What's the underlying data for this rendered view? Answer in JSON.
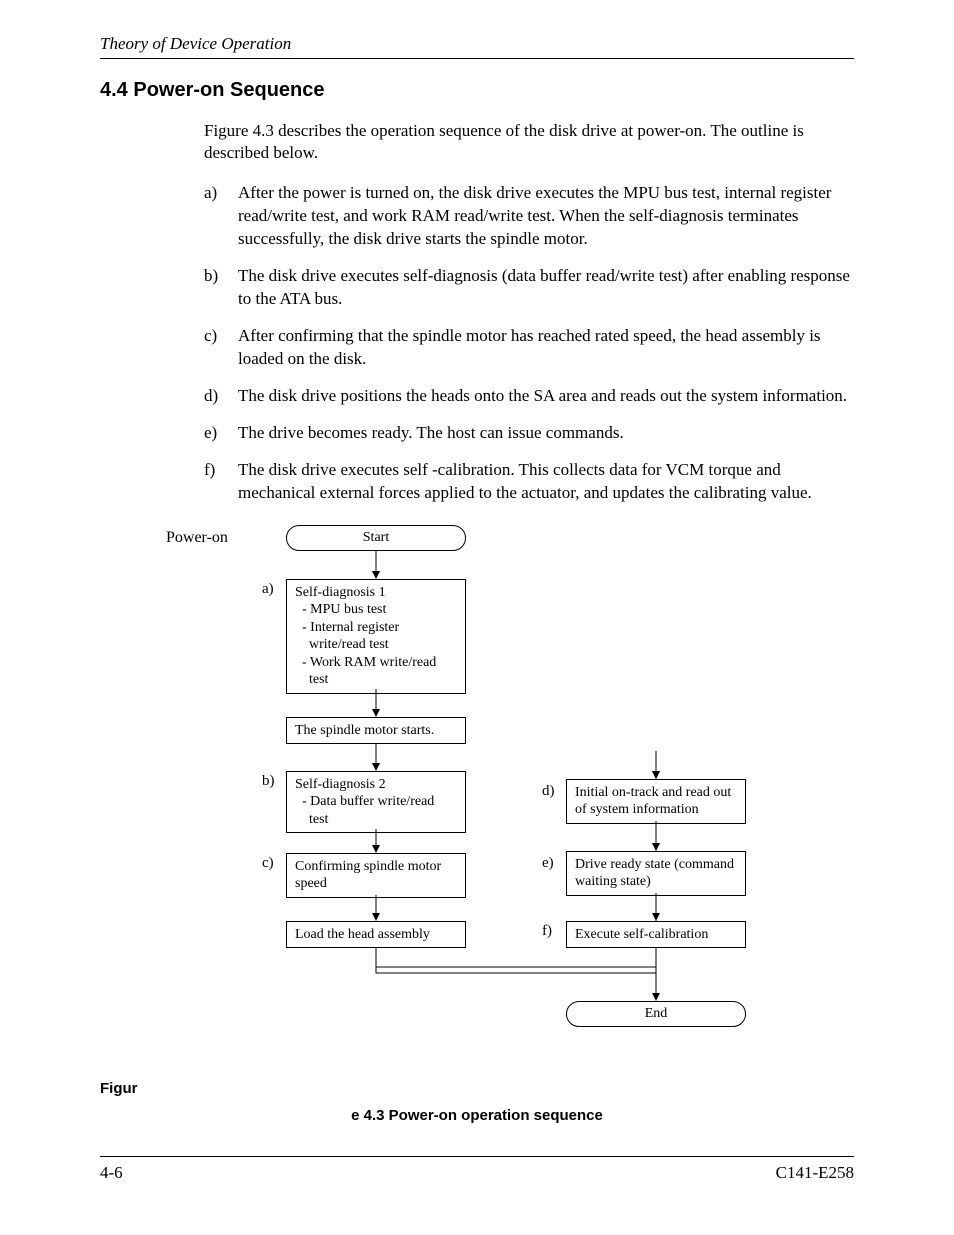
{
  "header": {
    "title": "Theory of Device Operation"
  },
  "section": {
    "heading": "4.4  Power-on Sequence"
  },
  "intro": "Figure 4.3 describes the operation sequence of the disk drive at power-on.  The outline is described below.",
  "items": [
    {
      "label": "a)",
      "text": "After the power is turned on, the disk drive executes the MPU bus test, internal register read/write test, and work RAM read/write test.  When the self-diagnosis terminates successfully, the disk drive starts the spindle motor."
    },
    {
      "label": "b)",
      "text": "The disk drive executes self-diagnosis (data buffer read/write test) after enabling response to the ATA bus."
    },
    {
      "label": "c)",
      "text": "After confirming that the spindle motor has reached rated speed, the head assembly is loaded on the disk."
    },
    {
      "label": "d)",
      "text": "The disk drive positions the heads onto the SA area and reads out the system information."
    },
    {
      "label": "e)",
      "text": "The drive becomes ready.  The host can issue commands."
    },
    {
      "label": "f)",
      "text": "The disk drive executes self -calibration.  This collects data for VCM torque and mechanical external forces applied to the actuator, and updates the calibrating value."
    }
  ],
  "flow": {
    "poweron": "Power-on",
    "start": "Start",
    "end": "End",
    "a_label": "a)",
    "b_label": "b)",
    "c_label": "c)",
    "d_label": "d)",
    "e_label": "e)",
    "f_label": "f)",
    "box_a_title": "Self-diagnosis 1",
    "box_a_l1": "- MPU bus test",
    "box_a_l2": "- Internal register",
    "box_a_l2b": "write/read test",
    "box_a_l3": "- Work RAM write/read",
    "box_a_l3b": "test",
    "box_spindle": "The spindle motor starts.",
    "box_b_title": "Self-diagnosis 2",
    "box_b_l1": "- Data buffer write/read",
    "box_b_l1b": "test",
    "box_c": "Confirming spindle motor speed",
    "box_load": "Load the head assembly",
    "box_d": "Initial on-track and read out of system information",
    "box_e": "Drive ready state (command waiting state)",
    "box_f": "Execute self-calibration"
  },
  "figure": {
    "left": "Figur",
    "center": "e 4.3  Power-on operation sequence"
  },
  "footer": {
    "left": "4-6",
    "right": "C141-E258"
  }
}
